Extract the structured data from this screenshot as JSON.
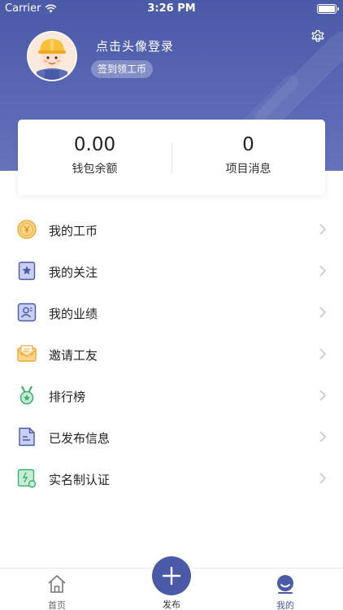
{
  "status_bar": {
    "carrier": "Carrier",
    "time": "3:26 PM"
  },
  "profile": {
    "login_prompt": "点击头像登录",
    "checkin_label": "签到领工币"
  },
  "stats": {
    "wallet_value": "0.00",
    "wallet_label": "钱包余额",
    "messages_value": "0",
    "messages_label": "项目消息"
  },
  "menu": {
    "items": [
      {
        "label": "我的工币",
        "icon": "coin-icon"
      },
      {
        "label": "我的关注",
        "icon": "star-bookmark-icon"
      },
      {
        "label": "我的业绩",
        "icon": "user-card-icon"
      },
      {
        "label": "邀请工友",
        "icon": "envelope-icon"
      },
      {
        "label": "排行榜",
        "icon": "medal-icon"
      },
      {
        "label": "已发布信息",
        "icon": "document-icon"
      },
      {
        "label": "实名制认证",
        "icon": "id-verify-icon"
      }
    ]
  },
  "tabbar": {
    "home_label": "首页",
    "publish_label": "发布",
    "mine_label": "我的"
  },
  "colors": {
    "primary": "#4a5aa7",
    "header_gradient_end": "#6673bb"
  }
}
